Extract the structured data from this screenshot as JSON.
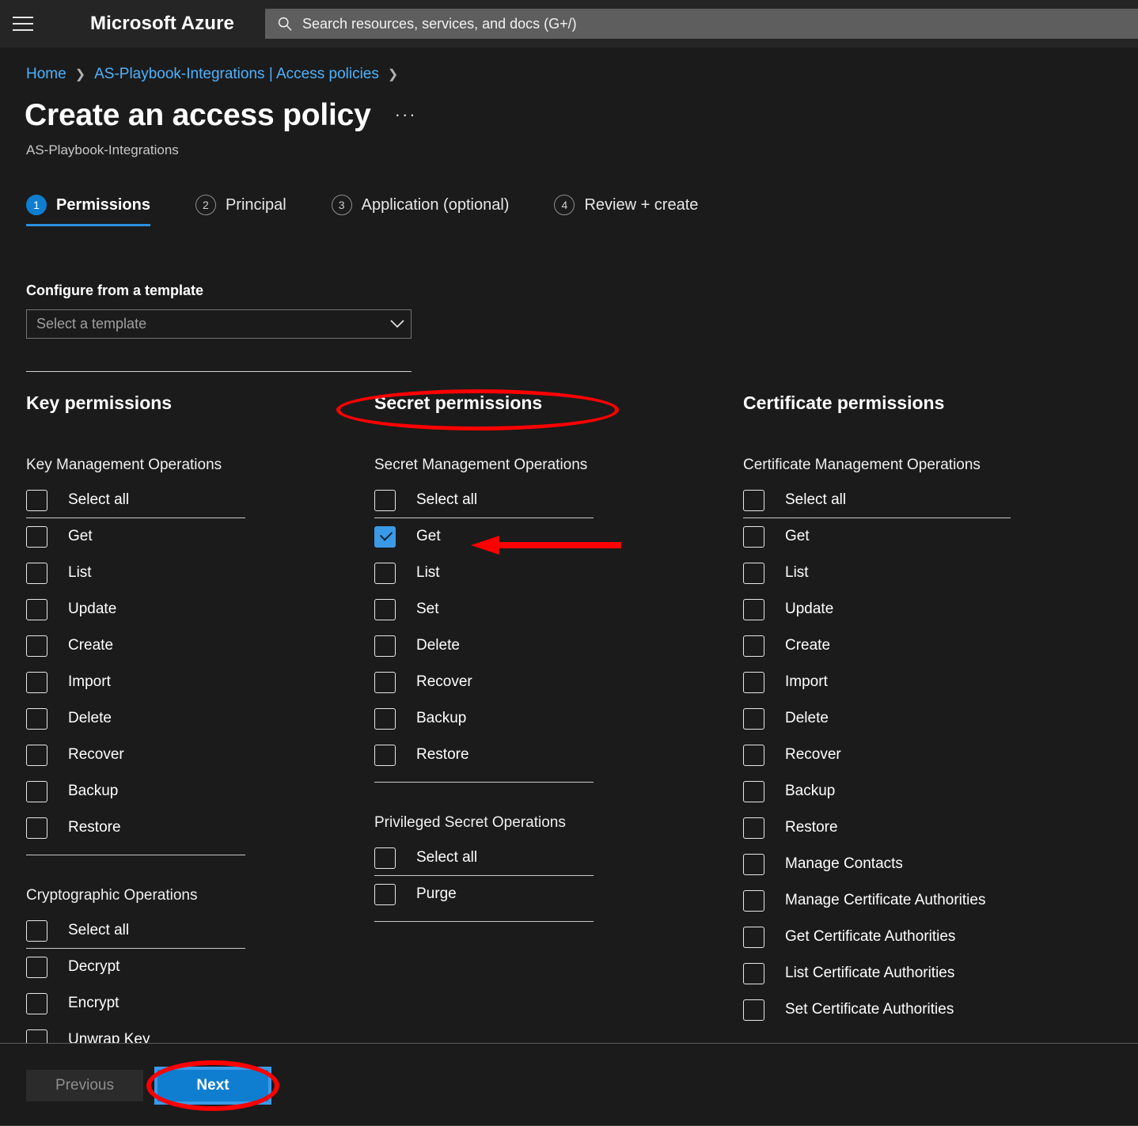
{
  "topbar": {
    "menu_icon": "hamburger-icon",
    "brand": "Microsoft Azure",
    "search": {
      "icon": "search-icon",
      "placeholder": "Search resources, services, and docs (G+/)",
      "value": ""
    }
  },
  "breadcrumb": {
    "items": [
      "Home",
      "AS-Playbook-Integrations | Access policies"
    ],
    "separator": "❯"
  },
  "header": {
    "title": "Create an access policy",
    "more_label": "···",
    "subtitle": "AS-Playbook-Integrations"
  },
  "steps": [
    {
      "number": "1",
      "label": "Permissions",
      "state": "active"
    },
    {
      "number": "2",
      "label": "Principal",
      "state": "inactive"
    },
    {
      "number": "3",
      "label": "Application (optional)",
      "state": "inactive"
    },
    {
      "number": "4",
      "label": "Review + create",
      "state": "inactive"
    }
  ],
  "template": {
    "label": "Configure from a template",
    "placeholder": "Select a template",
    "value": "",
    "chevron_icon": "chevron-down-icon"
  },
  "columns": [
    {
      "id": "key",
      "heading": "Key permissions",
      "groups": [
        {
          "title": "Key Management Operations",
          "select_all": {
            "label": "Select all",
            "checked": false
          },
          "items": [
            {
              "label": "Get",
              "checked": false
            },
            {
              "label": "List",
              "checked": false
            },
            {
              "label": "Update",
              "checked": false
            },
            {
              "label": "Create",
              "checked": false
            },
            {
              "label": "Import",
              "checked": false
            },
            {
              "label": "Delete",
              "checked": false
            },
            {
              "label": "Recover",
              "checked": false
            },
            {
              "label": "Backup",
              "checked": false
            },
            {
              "label": "Restore",
              "checked": false
            }
          ]
        },
        {
          "title": "Cryptographic Operations",
          "select_all": {
            "label": "Select all",
            "checked": false
          },
          "items": [
            {
              "label": "Decrypt",
              "checked": false
            },
            {
              "label": "Encrypt",
              "checked": false
            },
            {
              "label": "Unwrap Key",
              "checked": false
            }
          ]
        }
      ]
    },
    {
      "id": "secret",
      "heading": "Secret permissions",
      "groups": [
        {
          "title": "Secret Management Operations",
          "select_all": {
            "label": "Select all",
            "checked": false
          },
          "items": [
            {
              "label": "Get",
              "checked": true
            },
            {
              "label": "List",
              "checked": false
            },
            {
              "label": "Set",
              "checked": false
            },
            {
              "label": "Delete",
              "checked": false
            },
            {
              "label": "Recover",
              "checked": false
            },
            {
              "label": "Backup",
              "checked": false
            },
            {
              "label": "Restore",
              "checked": false
            }
          ]
        },
        {
          "title": "Privileged Secret Operations",
          "select_all": {
            "label": "Select all",
            "checked": false
          },
          "items": [
            {
              "label": "Purge",
              "checked": false
            }
          ]
        }
      ]
    },
    {
      "id": "certificate",
      "heading": "Certificate permissions",
      "groups": [
        {
          "title": "Certificate Management Operations",
          "select_all": {
            "label": "Select all",
            "checked": false
          },
          "items": [
            {
              "label": "Get",
              "checked": false
            },
            {
              "label": "List",
              "checked": false
            },
            {
              "label": "Update",
              "checked": false
            },
            {
              "label": "Create",
              "checked": false
            },
            {
              "label": "Import",
              "checked": false
            },
            {
              "label": "Delete",
              "checked": false
            },
            {
              "label": "Recover",
              "checked": false
            },
            {
              "label": "Backup",
              "checked": false
            },
            {
              "label": "Restore",
              "checked": false
            },
            {
              "label": "Manage Contacts",
              "checked": false
            },
            {
              "label": "Manage Certificate Authorities",
              "checked": false
            },
            {
              "label": "Get Certificate Authorities",
              "checked": false
            },
            {
              "label": "List Certificate Authorities",
              "checked": false
            },
            {
              "label": "Set Certificate Authorities",
              "checked": false
            }
          ]
        }
      ]
    }
  ],
  "footer": {
    "previous_label": "Previous",
    "previous_enabled": false,
    "next_label": "Next",
    "next_enabled": true
  },
  "annotations": [
    {
      "type": "ellipse",
      "target": "secret-permissions-heading",
      "color": "#ff0000"
    },
    {
      "type": "arrow",
      "target": "secret-get-checkbox",
      "color": "#ff0000",
      "direction": "left"
    },
    {
      "type": "ellipse",
      "target": "next-button",
      "color": "#ff0000"
    }
  ],
  "colors": {
    "page_background": "#1b1b1b",
    "topbar_background": "#252525",
    "search_background": "#5e5e5e",
    "accent_blue": "#0f7ed0",
    "checkbox_checked": "#3b9ae8",
    "link_blue": "#4db2ff",
    "annotation_red": "#ff0000"
  }
}
